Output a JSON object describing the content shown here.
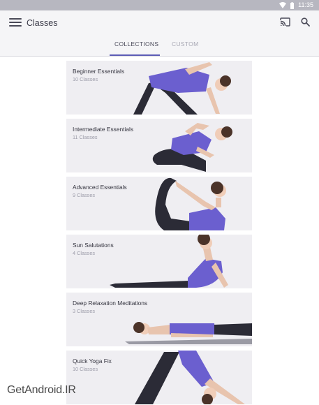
{
  "status": {
    "time": "11:35"
  },
  "app_bar": {
    "title": "Classes"
  },
  "tabs": [
    {
      "label": "COLLECTIONS",
      "active": true
    },
    {
      "label": "CUSTOM",
      "active": false
    }
  ],
  "collections": [
    {
      "title": "Beginner Essentials",
      "count": "10 Classes"
    },
    {
      "title": "Intermediate Essentials",
      "count": "11 Classes"
    },
    {
      "title": "Advanced Essentials",
      "count": "9 Classes"
    },
    {
      "title": "Sun Salutations",
      "count": "4 Classes"
    },
    {
      "title": "Deep Relaxation Meditations",
      "count": "3 Classes"
    },
    {
      "title": "Quick Yoga Fix",
      "count": "10 Classes"
    }
  ],
  "watermark": "GetAndroid.IR",
  "colors": {
    "accent": "#5b5bb5",
    "top_purple": "#6b5fcf",
    "legging": "#2b2b36",
    "card_bg": "#efeef2"
  }
}
